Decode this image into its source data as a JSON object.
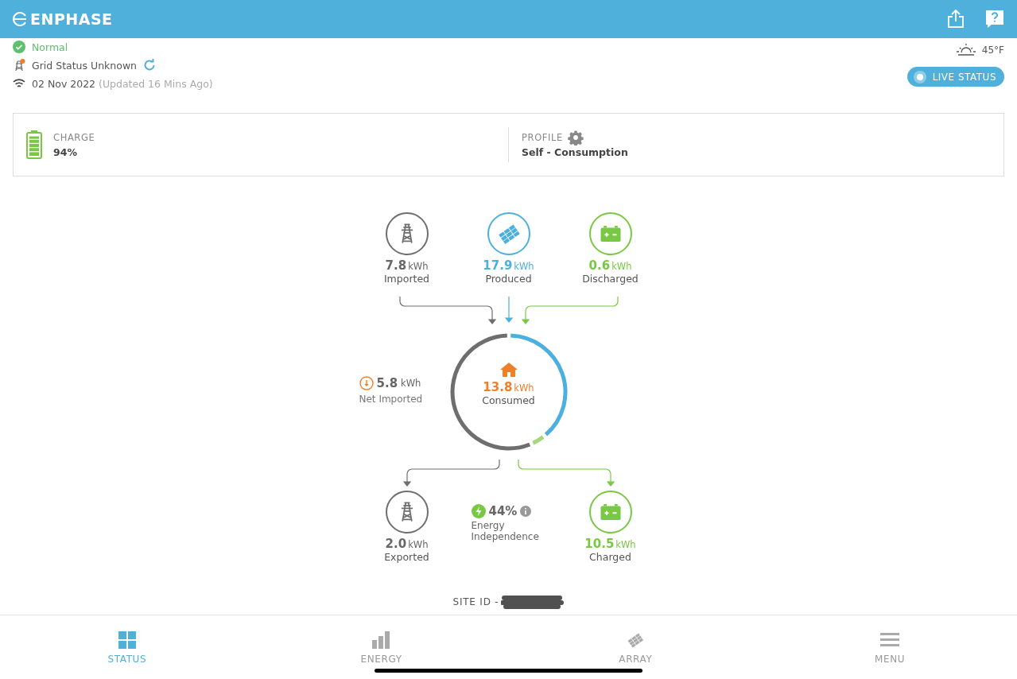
{
  "header": {
    "logo": "ENPHASE"
  },
  "status": {
    "system": "Normal",
    "grid": "Grid Status Unknown",
    "date": "02 Nov 2022",
    "updated": "(Updated 16 Mins Ago)"
  },
  "weather": {
    "temperature": "45°F"
  },
  "live_status": {
    "label": "LIVE STATUS"
  },
  "summary": {
    "charge": {
      "label": "CHARGE",
      "value": "94%",
      "level": 0.94
    },
    "profile": {
      "label": "PROFILE",
      "value": "Self - Consumption"
    }
  },
  "sources": [
    {
      "kind": "grid",
      "value": "7.8",
      "unit": "kWh",
      "label": "Imported",
      "color": "#6e6e6e"
    },
    {
      "kind": "solar",
      "value": "17.9",
      "unit": "kWh",
      "label": "Produced",
      "color": "#4bb0de"
    },
    {
      "kind": "battery",
      "value": "0.6",
      "unit": "kWh",
      "label": "Discharged",
      "color": "#79c843"
    }
  ],
  "consumption": {
    "value": "13.8",
    "unit": "kWh",
    "label": "Consumed"
  },
  "net": {
    "value": "5.8",
    "unit": "kWh",
    "label": "Net Imported"
  },
  "sinks": [
    {
      "kind": "grid",
      "value": "2.0",
      "unit": "kWh",
      "label": "Exported",
      "color": "#6e6e6e"
    },
    {
      "kind": "battery",
      "value": "10.5",
      "unit": "kWh",
      "label": "Charged",
      "color": "#79c843"
    }
  ],
  "independence": {
    "value": "44%",
    "label": "Energy Independence"
  },
  "site_id": "SITE ID -",
  "nav": [
    {
      "kind": "status",
      "label": "STATUS",
      "selected": true
    },
    {
      "kind": "energy",
      "label": "ENERGY",
      "selected": false
    },
    {
      "kind": "array",
      "label": "ARRAY",
      "selected": false
    },
    {
      "kind": "menu",
      "label": "MENU",
      "selected": false
    }
  ]
}
